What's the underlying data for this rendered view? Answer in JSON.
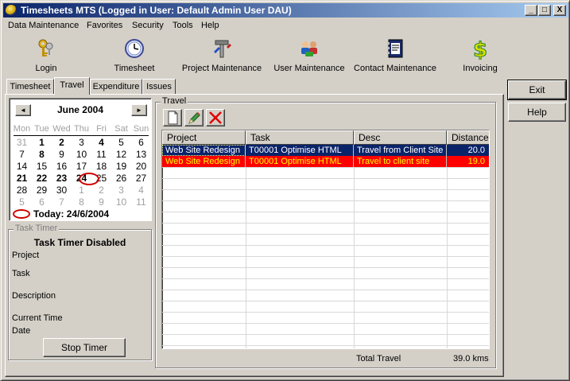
{
  "window": {
    "title": "Timesheets MTS (Logged in User: Default Admin User DAU)"
  },
  "titlebar_buttons": {
    "minimize": "_",
    "maximize": "□",
    "close": "X"
  },
  "menu": [
    "Data Maintenance",
    "Favorites",
    "Security",
    "Tools",
    "Help"
  ],
  "toolbar": [
    {
      "label": "Login",
      "icon": "keys-icon"
    },
    {
      "label": "Timesheet",
      "icon": "clock-icon"
    },
    {
      "label": "Project Maintenance",
      "icon": "tools-icon"
    },
    {
      "label": "User Maintenance",
      "icon": "users-icon"
    },
    {
      "label": "Contact Maintenance",
      "icon": "address-book-icon"
    },
    {
      "label": "Invoicing",
      "icon": "dollar-icon"
    }
  ],
  "tabs": [
    "Timesheet",
    "Travel",
    "Expenditure",
    "Issues"
  ],
  "active_tab": "Travel",
  "calendar": {
    "month_title": "June 2004",
    "prev": "◄",
    "next": "►",
    "weekdays": [
      "Mon",
      "Tue",
      "Wed",
      "Thu",
      "Fri",
      "Sat",
      "Sun"
    ],
    "weeks": [
      [
        "31",
        "1",
        "2",
        "3",
        "4",
        "5",
        "6"
      ],
      [
        "7",
        "8",
        "9",
        "10",
        "11",
        "12",
        "13"
      ],
      [
        "14",
        "15",
        "16",
        "17",
        "18",
        "19",
        "20"
      ],
      [
        "21",
        "22",
        "23",
        "24",
        "25",
        "26",
        "27"
      ],
      [
        "28",
        "29",
        "30",
        "1",
        "2",
        "3",
        "4"
      ],
      [
        "5",
        "6",
        "7",
        "8",
        "9",
        "10",
        "11"
      ]
    ],
    "bold_days": [
      "1",
      "2",
      "4",
      "8",
      "21",
      "22",
      "23",
      "24"
    ],
    "selected_day": "24",
    "today_label": "Today: 24/6/2004"
  },
  "task_timer": {
    "legend": "Task Timer",
    "status": "Task Timer Disabled",
    "fields": [
      "Project",
      "Task",
      "Description",
      "Current Time",
      "Date"
    ],
    "stop_button": "Stop Timer"
  },
  "travel": {
    "legend": "Travel",
    "columns": [
      "Project",
      "Task",
      "Desc",
      "Distance"
    ],
    "rows": [
      {
        "project": "Web Site Redesign",
        "task": "T00001 Optimise HTML",
        "desc": "Travel from Client Site",
        "distance": "20.0",
        "style": "selected"
      },
      {
        "project": "Web Site Redesign",
        "task": "T00001 Optimise HTML",
        "desc": "Travel to client site",
        "distance": "19.0",
        "style": "highlight"
      }
    ],
    "total_label": "Total Travel",
    "total_value": "39.0 kms"
  },
  "side_buttons": {
    "exit": "Exit",
    "help": "Help"
  },
  "colors": {
    "selected_row": "#0a246a",
    "highlight_row": "#ff0000",
    "highlight_text": "#ffff00",
    "title_start": "#0a246a",
    "title_end": "#a6caf0"
  }
}
